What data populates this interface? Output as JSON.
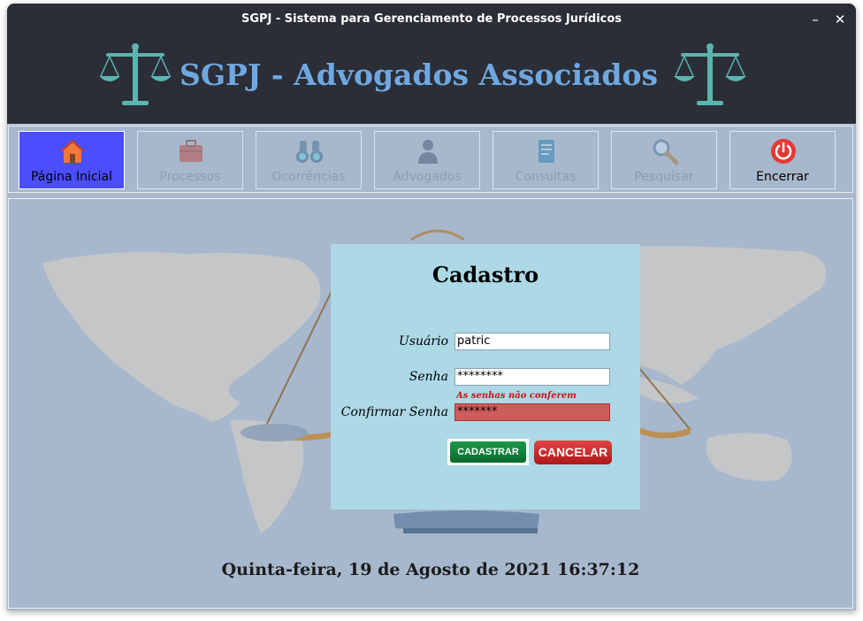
{
  "window": {
    "title": "SGPJ - Sistema para Gerenciamento de Processos Jurídicos",
    "minimize": "–",
    "close": "✕"
  },
  "banner": {
    "title": "SGPJ - Advogados Associados",
    "icon": "scales-of-justice-icon"
  },
  "toolbar": {
    "items": [
      {
        "label": "Página Inicial",
        "icon": "home-icon",
        "state": "active"
      },
      {
        "label": "Processos",
        "icon": "briefcase-icon",
        "state": "disabled"
      },
      {
        "label": "Ocorrências",
        "icon": "binoculars-icon",
        "state": "disabled"
      },
      {
        "label": "Advogados",
        "icon": "people-icon",
        "state": "disabled"
      },
      {
        "label": "Consultas",
        "icon": "document-icon",
        "state": "disabled"
      },
      {
        "label": "Pesquisar",
        "icon": "magnifier-icon",
        "state": "disabled"
      },
      {
        "label": "Encerrar",
        "icon": "power-icon",
        "state": "enabled"
      }
    ]
  },
  "dialog": {
    "title": "Cadastro",
    "usuario_label": "Usuário",
    "usuario_value": "patric",
    "senha_label": "Senha",
    "senha_value": "********",
    "error": "As senhas não conferem",
    "confirmar_label": "Confirmar Senha",
    "confirmar_value": "*******",
    "cadastrar": "CADASTRAR",
    "cancelar": "CANCELAR"
  },
  "status": {
    "datetime": "Quinta-feira, 19 de Agosto de 2021 16:37:12"
  },
  "colors": {
    "accent": "#4a4eff",
    "banner_text": "#6fa8e0",
    "dialog_bg": "#add8e6",
    "error_field": "#cd5c5c",
    "cadastrar": "#0a6a2a",
    "cancelar": "#b01818"
  }
}
